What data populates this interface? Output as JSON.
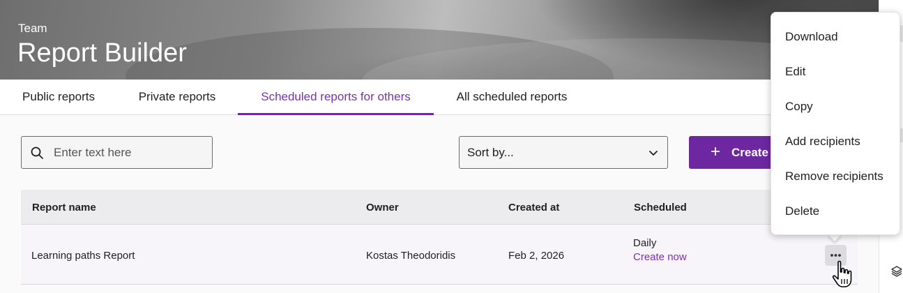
{
  "header": {
    "team_label": "Team",
    "title": "Report Builder"
  },
  "tabs": [
    {
      "label": "Public reports",
      "active": false
    },
    {
      "label": "Private reports",
      "active": false
    },
    {
      "label": "Scheduled reports for others",
      "active": true
    },
    {
      "label": "All scheduled reports",
      "active": false
    }
  ],
  "search": {
    "placeholder": "Enter text here",
    "value": "",
    "icon": "search-icon"
  },
  "sort": {
    "selected": "Sort by...",
    "icon": "chevron-down-icon"
  },
  "create_button": {
    "label": "Create",
    "icon": "plus-icon"
  },
  "table": {
    "columns": [
      "Report name",
      "Owner",
      "Created at",
      "Scheduled"
    ],
    "rows": [
      {
        "report_name": "Learning paths Report",
        "owner": "Kostas Theodoridis",
        "created_at": "Feb 2, 2026",
        "scheduled": "Daily",
        "action_link": "Create now",
        "more_icon": "more-horizontal-icon"
      }
    ]
  },
  "menu": {
    "items": [
      "Download",
      "Edit",
      "Copy",
      "Add recipients",
      "Remove recipients",
      "Delete"
    ]
  },
  "colors": {
    "accent": "#6c27a1",
    "accent_text": "#7b2fb1",
    "table_header_bg": "#ececee",
    "row_bg": "#f7f5fa"
  }
}
